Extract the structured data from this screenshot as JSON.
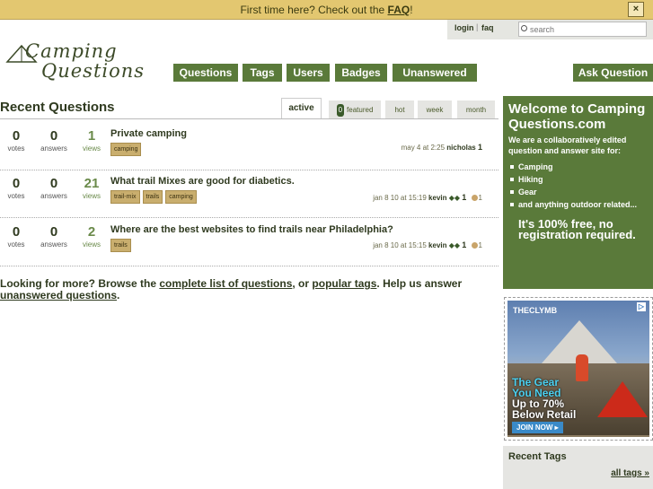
{
  "banner": {
    "prefix": "First time here? Check out the ",
    "link": "FAQ",
    "suffix": "!",
    "close": "×"
  },
  "topbar": {
    "login": "login",
    "sep": "|",
    "faq": "faq",
    "search_placeholder": "search"
  },
  "logo": {
    "line1": "Camping",
    "line2": "Questions"
  },
  "nav": {
    "questions": "Questions",
    "tags": "Tags",
    "users": "Users",
    "badges": "Badges",
    "unanswered": "Unanswered",
    "ask": "Ask Question"
  },
  "main": {
    "title": "Recent Questions",
    "tabs": {
      "active": "active",
      "featured_count": "0",
      "featured": "featured",
      "hot": "hot",
      "week": "week",
      "month": "month"
    },
    "questions": [
      {
        "votes": "0",
        "votes_label": "votes",
        "answers": "0",
        "answers_label": "answers",
        "views": "1",
        "views_label": "views",
        "title": "Private camping",
        "tags": [
          "camping"
        ],
        "time": "may 4 at 2:25",
        "user": "nicholas",
        "rep": "1"
      },
      {
        "votes": "0",
        "votes_label": "votes",
        "answers": "0",
        "answers_label": "answers",
        "views": "21",
        "views_label": "views",
        "title": "What trail Mixes are good for diabetics.",
        "tags": [
          "trail-mix",
          "trails",
          "camping"
        ],
        "time": "jan 8 10 at 15:19",
        "user": "kevin",
        "rep": "1",
        "badges": "1"
      },
      {
        "votes": "0",
        "votes_label": "votes",
        "answers": "0",
        "answers_label": "answers",
        "views": "2",
        "views_label": "views",
        "title": "Where are the best websites to find trails near Philadelphia?",
        "tags": [
          "trails"
        ],
        "time": "jan 8 10 at 15:15",
        "user": "kevin",
        "rep": "1",
        "badges": "1"
      }
    ],
    "more": {
      "p1": "Looking for more? Browse the ",
      "link1": "complete list of questions",
      "p2": ", or ",
      "link2": "popular tags",
      "p3": ". Help us answer ",
      "link3": "unanswered questions",
      "p4": "."
    }
  },
  "sidebar": {
    "welcome_title": "Welcome to Camping Questions.com",
    "welcome_desc": "We are a collaboratively edited question and answer site for:",
    "topics": [
      "Camping",
      "Hiking",
      "Gear",
      "and anything outdoor related..."
    ],
    "free": "It's 100% free, no registration required.",
    "ad": {
      "brand": "THECLYMB",
      "line1": "The Gear",
      "line2": "You Need",
      "line3": "Up to 70%",
      "line4": "Below Retail",
      "join": "JOIN NOW ▸",
      "close": "▷"
    },
    "recent_tags": "Recent Tags",
    "all_tags": "all tags »"
  }
}
